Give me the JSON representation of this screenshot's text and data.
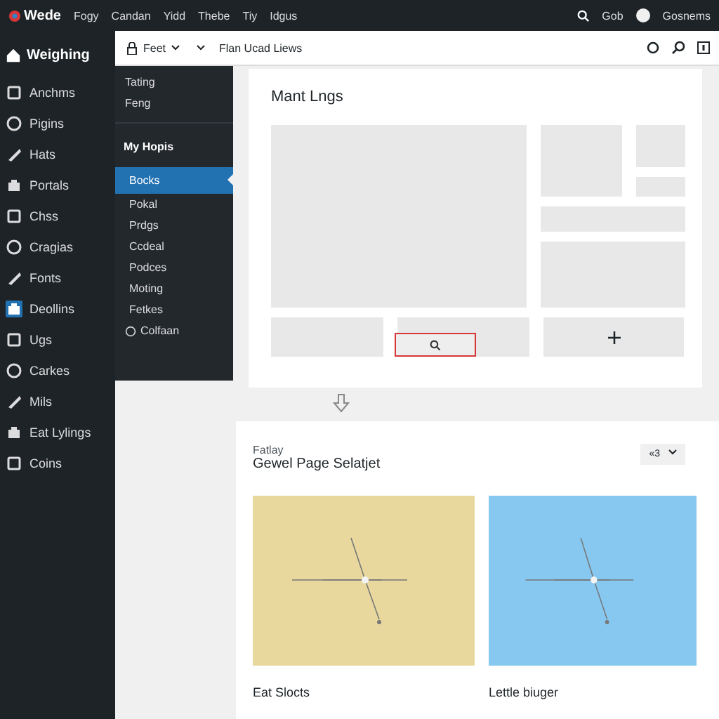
{
  "top_bar": {
    "logo": "Wede",
    "menu": [
      "Fogy",
      "Candan",
      "Yidd",
      "Thebe",
      "Tiy",
      "Idgus"
    ],
    "search_label": "Gob",
    "user": "Gosnems"
  },
  "sidebar": {
    "header": "Weighing",
    "items": [
      {
        "label": "Anchms",
        "selected": false
      },
      {
        "label": "Pigins",
        "selected": false
      },
      {
        "label": "Hats",
        "selected": false
      },
      {
        "label": "Portals",
        "selected": false
      },
      {
        "label": "Chss",
        "selected": false
      },
      {
        "label": "Cragias",
        "selected": false
      },
      {
        "label": "Fonts",
        "selected": false
      },
      {
        "label": "Deollins",
        "selected": true
      },
      {
        "label": "Ugs",
        "selected": false
      },
      {
        "label": "Carkes",
        "selected": false
      },
      {
        "label": "Mils",
        "selected": false
      },
      {
        "label": "Eat Lylings",
        "selected": false
      },
      {
        "label": "Coins",
        "selected": false
      }
    ]
  },
  "toolbar": {
    "dropdown": "Feet",
    "title": "Flan Ucad Liews"
  },
  "flyout": {
    "top_items": [
      "Tating",
      "Feng"
    ],
    "heading": "My Hopis",
    "items": [
      {
        "label": "Bocks",
        "selected": true
      },
      {
        "label": "Pokal",
        "selected": false
      },
      {
        "label": "Prdgs",
        "selected": false
      },
      {
        "label": "Ccdeal",
        "selected": false
      },
      {
        "label": "Podces",
        "selected": false
      },
      {
        "label": "Moting",
        "selected": false
      },
      {
        "label": "Fetkes",
        "selected": false
      }
    ],
    "footer": "Colfaan"
  },
  "layout_card": {
    "title": "Mant Lngs"
  },
  "page_card": {
    "eyebrow": "Fatlay",
    "title": "Gewel Page Selatjet",
    "select": "«3",
    "options": [
      {
        "caption": "Eat Slocts",
        "color": "#e8d89e"
      },
      {
        "caption": "Lettle biuger",
        "color": "#86c8ef"
      }
    ]
  }
}
